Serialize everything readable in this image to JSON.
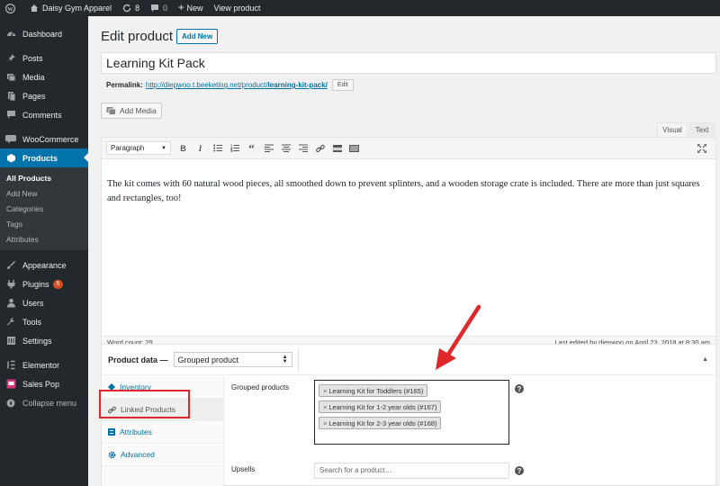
{
  "admin_bar": {
    "site_name": "Daisy Gym Apparel",
    "updates_count": "8",
    "comments_count": "0",
    "new_label": "New",
    "view_product_label": "View product"
  },
  "sidebar": {
    "dashboard": "Dashboard",
    "posts": "Posts",
    "media": "Media",
    "pages": "Pages",
    "comments": "Comments",
    "woocommerce": "WooCommerce",
    "products": "Products",
    "products_sub": [
      "All Products",
      "Add New",
      "Categories",
      "Tags",
      "Attributes"
    ],
    "appearance": "Appearance",
    "plugins": "Plugins",
    "plugins_badge": "5",
    "users": "Users",
    "tools": "Tools",
    "settings": "Settings",
    "elementor": "Elementor",
    "sales_pop": "Sales Pop",
    "collapse": "Collapse menu"
  },
  "page": {
    "title": "Edit product",
    "add_new": "Add New",
    "product_title": "Learning Kit Pack",
    "permalink_label": "Permalink:",
    "permalink_url": "http://diepwoo.t.beeketing.net/product/",
    "permalink_slug": "learning-kit-pack/",
    "permalink_edit": "Edit"
  },
  "editor": {
    "add_media": "Add Media",
    "tab_visual": "Visual",
    "tab_text": "Text",
    "format_select": "Paragraph",
    "content": "The kit comes with 60 natural wood pieces, all smoothed down to prevent splinters, and a wooden storage crate is included. There are more than just squares and rectangles, too!",
    "word_count": "Word count: 29",
    "last_edited": "Last edited by diepwoo on April 23, 2018 at 8:30 am"
  },
  "product_data": {
    "label": "Product data —",
    "type_select": "Grouped product",
    "tabs": [
      "Inventory",
      "Linked Products",
      "Attributes",
      "Advanced"
    ],
    "grouped_label": "Grouped products",
    "grouped_items": [
      "Learning Kit for Toddlers (#165)",
      "Learning Kit for 1-2 year olds (#167)",
      "Learning Kit for 2-3 year olds (#168)"
    ],
    "upsells_label": "Upsells",
    "upsells_placeholder": "Search for a product…"
  },
  "colors": {
    "admin_dark": "#23282d",
    "accent": "#0073aa",
    "highlight": "#e0282b"
  }
}
